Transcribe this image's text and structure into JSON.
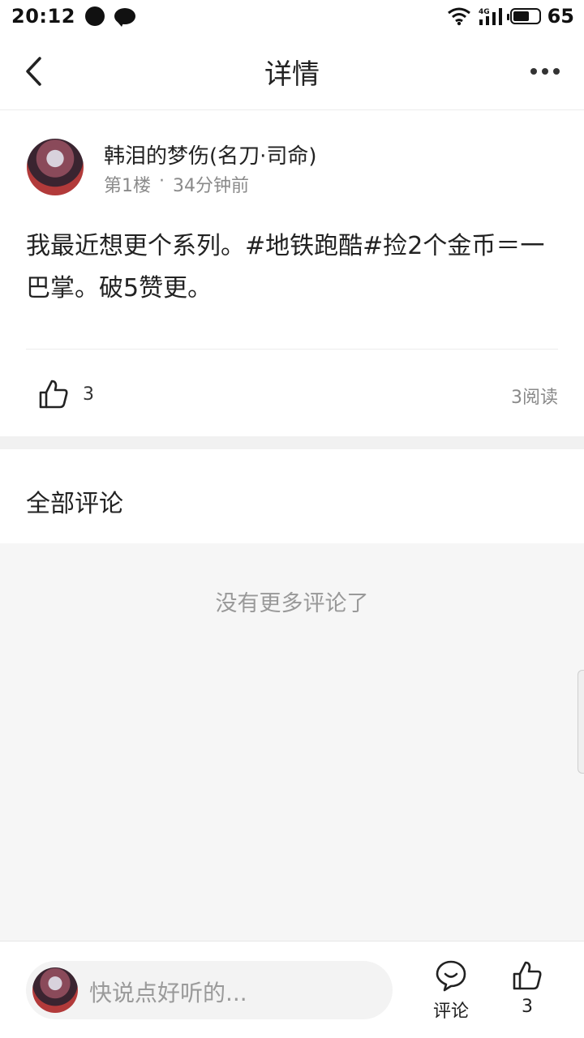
{
  "status_bar": {
    "time": "20:12",
    "battery_level": "65",
    "network": "4G"
  },
  "header": {
    "title": "详情"
  },
  "post": {
    "author": "韩泪的梦伤(名刀·司命)",
    "floor": "第1楼",
    "separator": "·",
    "time_ago": "34分钟前",
    "content": "我最近想更个系列。#地铁跑酷#捡2个金币＝一巴掌。破5赞更。",
    "like_count": "3",
    "read_count": "3阅读"
  },
  "comments": {
    "title": "全部评论",
    "empty_text": "没有更多评论了"
  },
  "bottom_bar": {
    "input_placeholder": "快说点好听的...",
    "comment_label": "评论",
    "like_count": "3"
  },
  "icons": {
    "back": "chevron-left-icon",
    "more": "more-dots-icon",
    "like": "thumbs-up-icon",
    "comment": "comment-bubble-icon"
  }
}
